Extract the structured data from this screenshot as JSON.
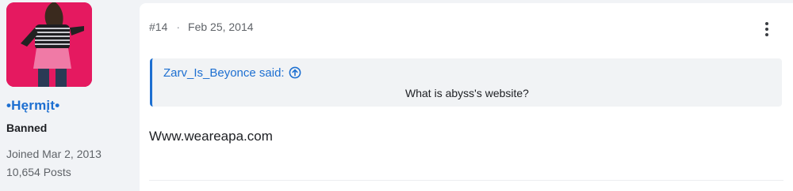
{
  "author": {
    "avatar_alt": "user avatar",
    "username": "•Hęrmįt•",
    "user_title": "Banned",
    "joined": "Joined Mar 2, 2013",
    "posts": "10,654 Posts"
  },
  "post": {
    "number": "#14",
    "separator": "·",
    "date": "Feb 25, 2014",
    "quote": {
      "author_label": "Zarv_Is_Beyonce said:",
      "text": "What is abyss's website?"
    },
    "message": "Www.weareapa.com"
  },
  "colors": {
    "accent": "#1d6fd1",
    "avatar_bg": "#e0125a"
  },
  "icons": {
    "more": "more-vertical-icon",
    "quote_link": "arrow-up-circle-icon"
  }
}
